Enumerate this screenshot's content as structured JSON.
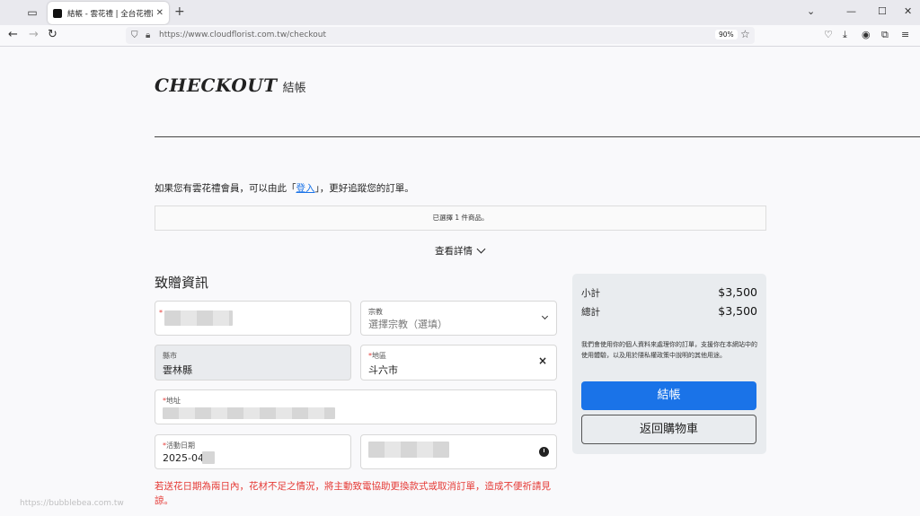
{
  "browser": {
    "tab_title": "結帳 - 雲花禮 | 全台花禮配送",
    "url": "https://www.cloudflorist.com.tw/checkout",
    "zoom": "90%"
  },
  "page": {
    "heading_en": "CHECKOUT",
    "heading_zh": "結帳",
    "member_prompt_before": "如果您有雲花禮會員，可以由此「",
    "login_link": "登入",
    "member_prompt_after": "」，更好追蹤您的訂單。",
    "selected_items": "已選擇 1 件商品。",
    "view_details": "查看詳情",
    "section_title": "致贈資訊"
  },
  "form": {
    "religion_label": "宗教",
    "religion_placeholder": "選擇宗教（選填）",
    "county_label": "縣市",
    "county_value": "雲林縣",
    "district_label": "地區",
    "district_value": "斗六市",
    "address_label": "地址",
    "event_date_label": "活動日期",
    "event_date_value": "2025-04-",
    "warning": "若送花日期為兩日內，花材不足之情況，將主動致電協助更換款式或取消訂單，造成不便祈請見諒。"
  },
  "summary": {
    "subtotal_label": "小計",
    "subtotal_value": "$3,500",
    "total_label": "總計",
    "total_value": "$3,500",
    "privacy_text": "我們會使用你的個人資料來處理你的訂單，支援你在本網站中的使用體驗，以及用於隱私權政策中說明的其他用途。",
    "checkout_button": "結帳",
    "back_to_cart_button": "返回購物車"
  },
  "status_bar_url": "https://bubblebea.com.tw"
}
